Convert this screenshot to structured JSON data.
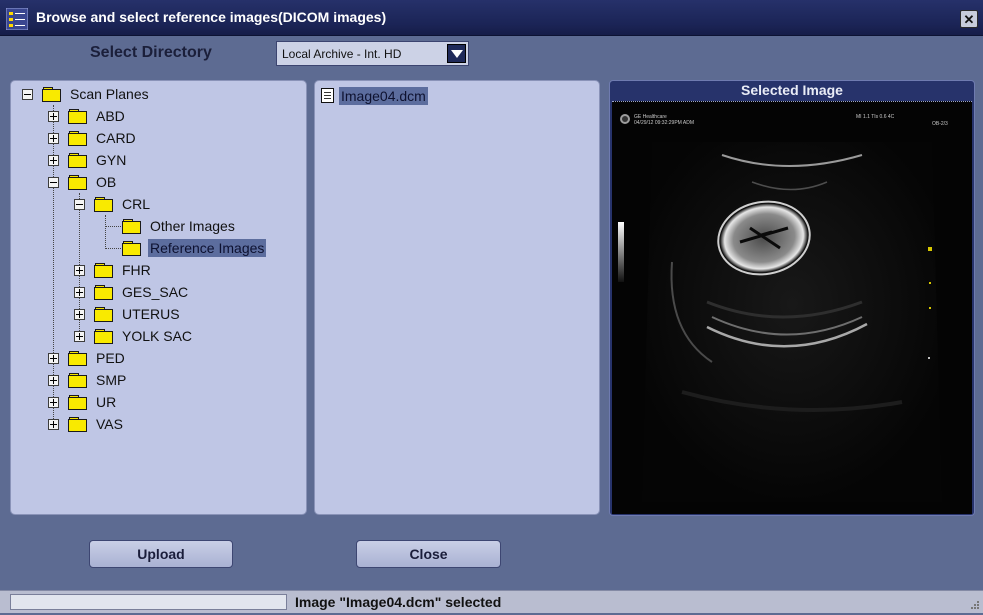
{
  "window": {
    "title": "Browse and select reference images(DICOM images)",
    "close_glyph": "✕"
  },
  "directory": {
    "label": "Select Directory",
    "selected": "Local Archive - Int. HD"
  },
  "tree": {
    "root": "Scan Planes",
    "items": [
      "ABD",
      "CARD",
      "GYN",
      "OB",
      "CRL",
      "Other Images",
      "Reference Images",
      "FHR",
      "GES_SAC",
      "UTERUS",
      "YOLK SAC",
      "PED",
      "SMP",
      "UR",
      "VAS"
    ],
    "selected": "Reference Images"
  },
  "files": {
    "items": [
      "Image04.dcm"
    ],
    "selected": "Image04.dcm"
  },
  "preview": {
    "title": "Selected Image",
    "overlay": {
      "brand": "GE Healthcare",
      "datetime": "04/29/12 09:32:29PM ADM",
      "index": "MI 1.1  TIs 0.6  4C",
      "probe": "OB-2/3"
    }
  },
  "buttons": {
    "upload": "Upload",
    "close": "Close"
  },
  "status": {
    "text": "Image \"Image04.dcm\" selected",
    "progress": 0
  },
  "colors": {
    "titlebar": "#1b2456",
    "panel": "#bfc6e5",
    "selection": "#5c6d9e",
    "background": "#5d6b92",
    "folder": "#f9ea00"
  }
}
